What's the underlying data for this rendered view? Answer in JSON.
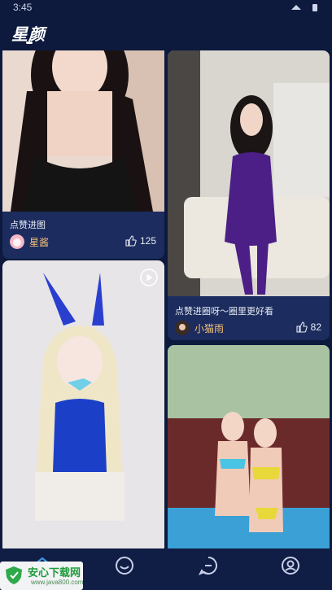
{
  "status_bar": {
    "time": "3:45"
  },
  "app": {
    "title": "星颜"
  },
  "feed": {
    "cards": [
      {
        "caption": "点赞进图",
        "author": "星酱",
        "likes": "125"
      },
      {
        "caption": "点赞进圈呀～圈里更好看",
        "author": "小猫雨",
        "likes": "82"
      }
    ]
  },
  "tabs": [
    {
      "icon": "home-icon"
    },
    {
      "icon": "smile-icon"
    },
    {
      "icon": "message-icon"
    },
    {
      "icon": "profile-icon"
    }
  ],
  "watermark": {
    "title": "安心下载网",
    "url": "www.java800.com"
  },
  "colors": {
    "background": "#0d1a3d",
    "card": "#1c2c5e",
    "author_name": "#f6c27a",
    "tab_active": "#3a9bdc"
  }
}
